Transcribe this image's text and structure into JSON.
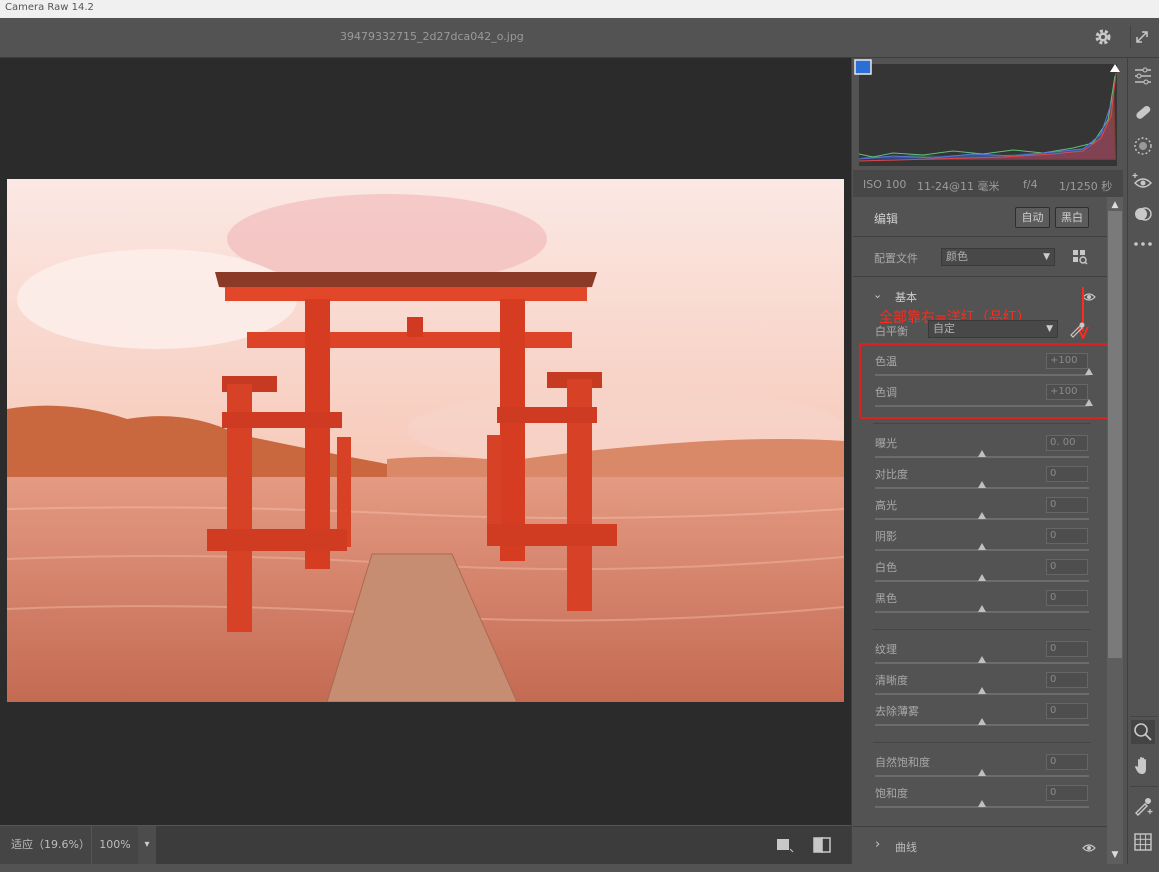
{
  "app": {
    "window_title": "Camera Raw 14.2",
    "filename": "39479332715_2d27dca042_o.jpg"
  },
  "exif": {
    "iso": "ISO 100",
    "focal": "11-24@11 毫米",
    "aperture": "f/4",
    "shutter": "1/1250 秒"
  },
  "edit": {
    "title": "编辑",
    "auto_label": "自动",
    "bw_label": "黑白",
    "profile_label": "配置文件",
    "profile_value": "颜色"
  },
  "basic": {
    "title": "基本",
    "wb_label": "白平衡",
    "wb_value": "自定",
    "annotation": "全部靠右=洋红（品红）",
    "sliders": [
      {
        "key": "temp",
        "label": "色温",
        "value": "+100",
        "pos": 1.0
      },
      {
        "key": "tint",
        "label": "色调",
        "value": "+100",
        "pos": 1.0
      },
      {
        "key": "exposure",
        "label": "曝光",
        "value": "0. 00",
        "pos": 0.5
      },
      {
        "key": "contrast",
        "label": "对比度",
        "value": "0",
        "pos": 0.5
      },
      {
        "key": "highlights",
        "label": "高光",
        "value": "0",
        "pos": 0.5
      },
      {
        "key": "shadows",
        "label": "阴影",
        "value": "0",
        "pos": 0.5
      },
      {
        "key": "whites",
        "label": "白色",
        "value": "0",
        "pos": 0.5
      },
      {
        "key": "blacks",
        "label": "黑色",
        "value": "0",
        "pos": 0.5
      },
      {
        "key": "texture",
        "label": "纹理",
        "value": "0",
        "pos": 0.5
      },
      {
        "key": "clarity",
        "label": "清晰度",
        "value": "0",
        "pos": 0.5
      },
      {
        "key": "dehaze",
        "label": "去除薄雾",
        "value": "0",
        "pos": 0.5
      },
      {
        "key": "vibrance",
        "label": "自然饱和度",
        "value": "0",
        "pos": 0.5
      },
      {
        "key": "saturation",
        "label": "饱和度",
        "value": "0",
        "pos": 0.5
      }
    ]
  },
  "curves": {
    "title": "曲线"
  },
  "bottom": {
    "fit_label": "适应（19.6%）",
    "zoom_label": "100%"
  },
  "colors": {
    "annotation_red": "#e0201e",
    "panel_bg": "#535353",
    "canvas_bg": "#2b2b2b"
  }
}
